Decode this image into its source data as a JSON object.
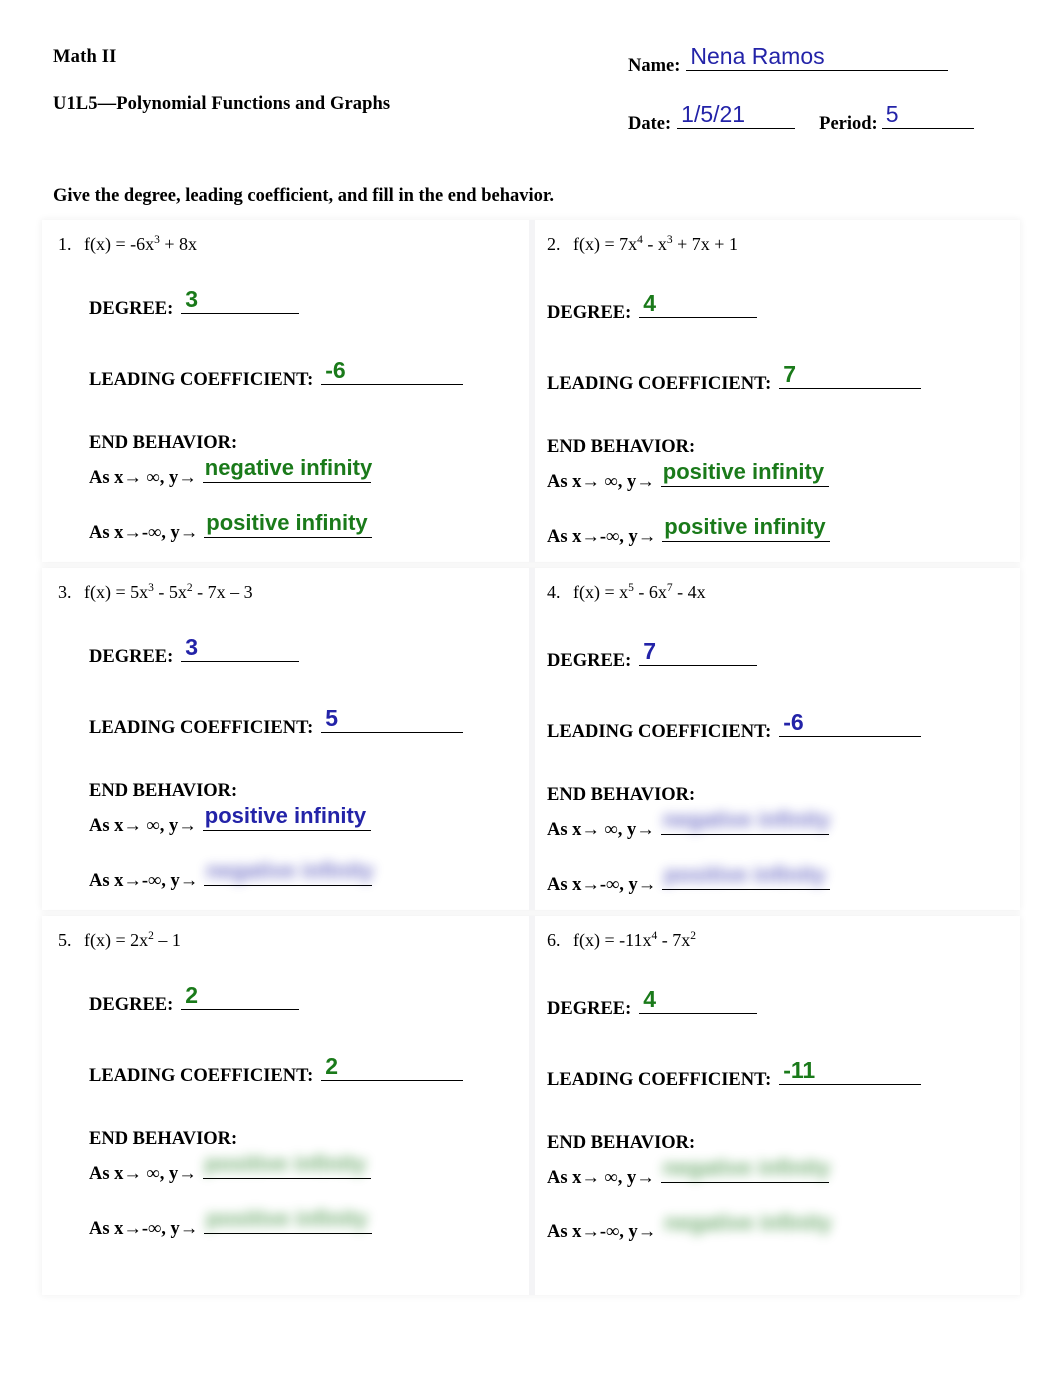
{
  "header": {
    "course": "Math II",
    "lesson": "U1L5—Polynomial Functions and Graphs",
    "name_label": "Name:",
    "name_value": "Nena Ramos",
    "date_label": "Date:",
    "date_value": "1/5/21",
    "period_label": "Period:",
    "period_value": "5"
  },
  "instruction": "Give the degree, leading coefficient, and fill in the end behavior.",
  "labels": {
    "degree": "DEGREE:",
    "leading_coefficient": "LEADING COEFFICIENT:",
    "end_behavior": "END BEHAVIOR:",
    "as_x_to_pos": "As x→ ∞, y→",
    "as_x_to_neg": "As x→-∞, y→"
  },
  "ink_colors": {
    "green": "#1a7a1a",
    "blue": "#2323a8"
  },
  "problems": [
    {
      "number": "1.",
      "function_html": "f(x) = -6x<sup>3</sup> + 8x",
      "degree": "3",
      "leading_coefficient": "-6",
      "end_behavior_positive": "negative infinity",
      "end_behavior_negative": "positive infinity"
    },
    {
      "number": "2.",
      "function_html": "f(x) = 7x<sup>4</sup> - x<sup>3</sup> + 7x + 1",
      "degree": "4",
      "leading_coefficient": "7",
      "end_behavior_positive": "positive infinity",
      "end_behavior_negative": "positive infinity"
    },
    {
      "number": "3.",
      "function_html": "f(x) = 5x<sup>3</sup> - 5x<sup>2</sup> - 7x – 3",
      "degree": "3",
      "leading_coefficient": "5",
      "end_behavior_positive": "positive infinity",
      "end_behavior_negative": "negative infinity"
    },
    {
      "number": "4.",
      "function_html": "f(x) = x<sup>5</sup> - 6x<sup>7</sup>  - 4x",
      "degree": "7",
      "leading_coefficient": "-6",
      "end_behavior_positive": "negative infinity",
      "end_behavior_negative": "positive infinity"
    },
    {
      "number": "5.",
      "function_html": "f(x) = 2x<sup>2</sup>  – 1",
      "degree": "2",
      "leading_coefficient": "2",
      "end_behavior_positive": "positive infinity",
      "end_behavior_negative": "positive infinity"
    },
    {
      "number": "6.",
      "function_html": "f(x) = -11x<sup>4</sup> - 7x<sup>2</sup>",
      "degree": "4",
      "leading_coefficient": "-11",
      "end_behavior_positive": "negative infinity",
      "end_behavior_negative": "negative infinity"
    }
  ]
}
